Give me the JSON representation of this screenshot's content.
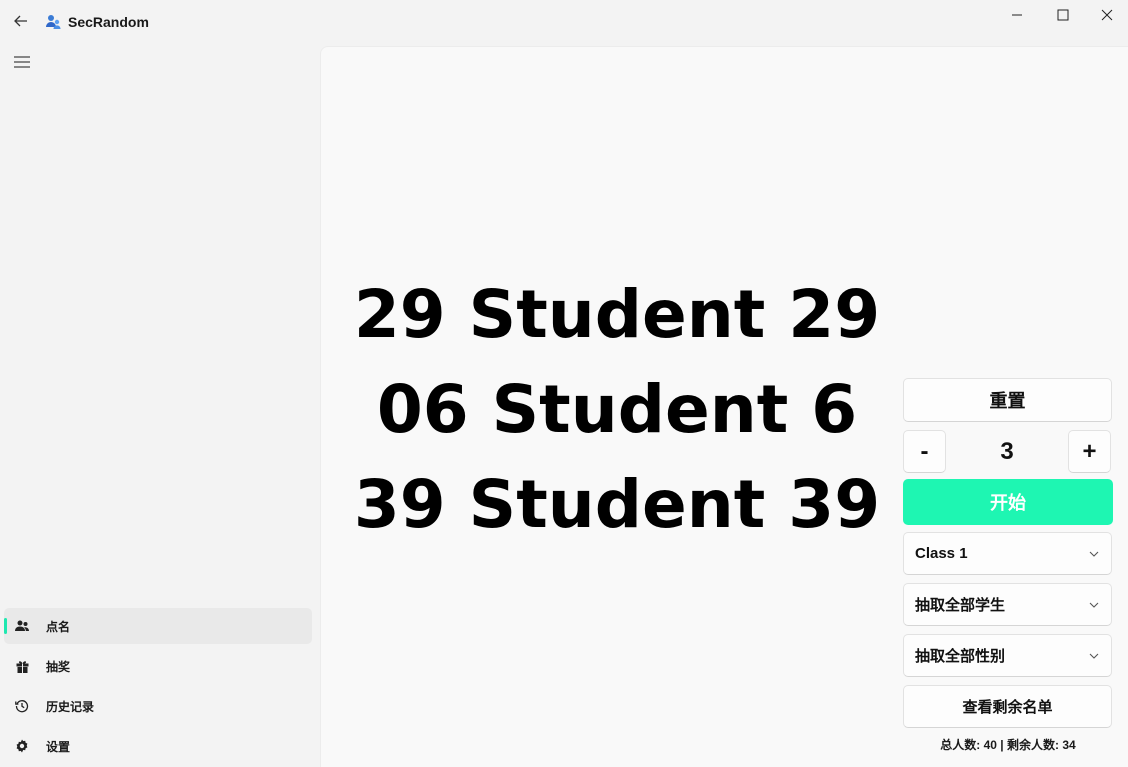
{
  "app": {
    "title": "SecRandom"
  },
  "sidebar": {
    "items": [
      {
        "label": "点名",
        "icon": "people-icon",
        "active": true
      },
      {
        "label": "抽奖",
        "icon": "gift-icon",
        "active": false
      },
      {
        "label": "历史记录",
        "icon": "history-icon",
        "active": false
      },
      {
        "label": "设置",
        "icon": "gear-icon",
        "active": false
      }
    ]
  },
  "main": {
    "results": [
      "29 Student 29",
      "06 Student 6",
      "39 Student 39"
    ],
    "reset_label": "重置",
    "stepper": {
      "minus": "-",
      "value": "3",
      "plus": "+"
    },
    "start_label": "开始",
    "class_select": "Class 1",
    "range_select": "抽取全部学生",
    "gender_select": "抽取全部性别",
    "remaining_label": "查看剩余名单",
    "stats": "总人数: 40 | 剩余人数: 34"
  },
  "colors": {
    "accent": "#1ef6b2",
    "indicator": "#1ee8b0"
  }
}
